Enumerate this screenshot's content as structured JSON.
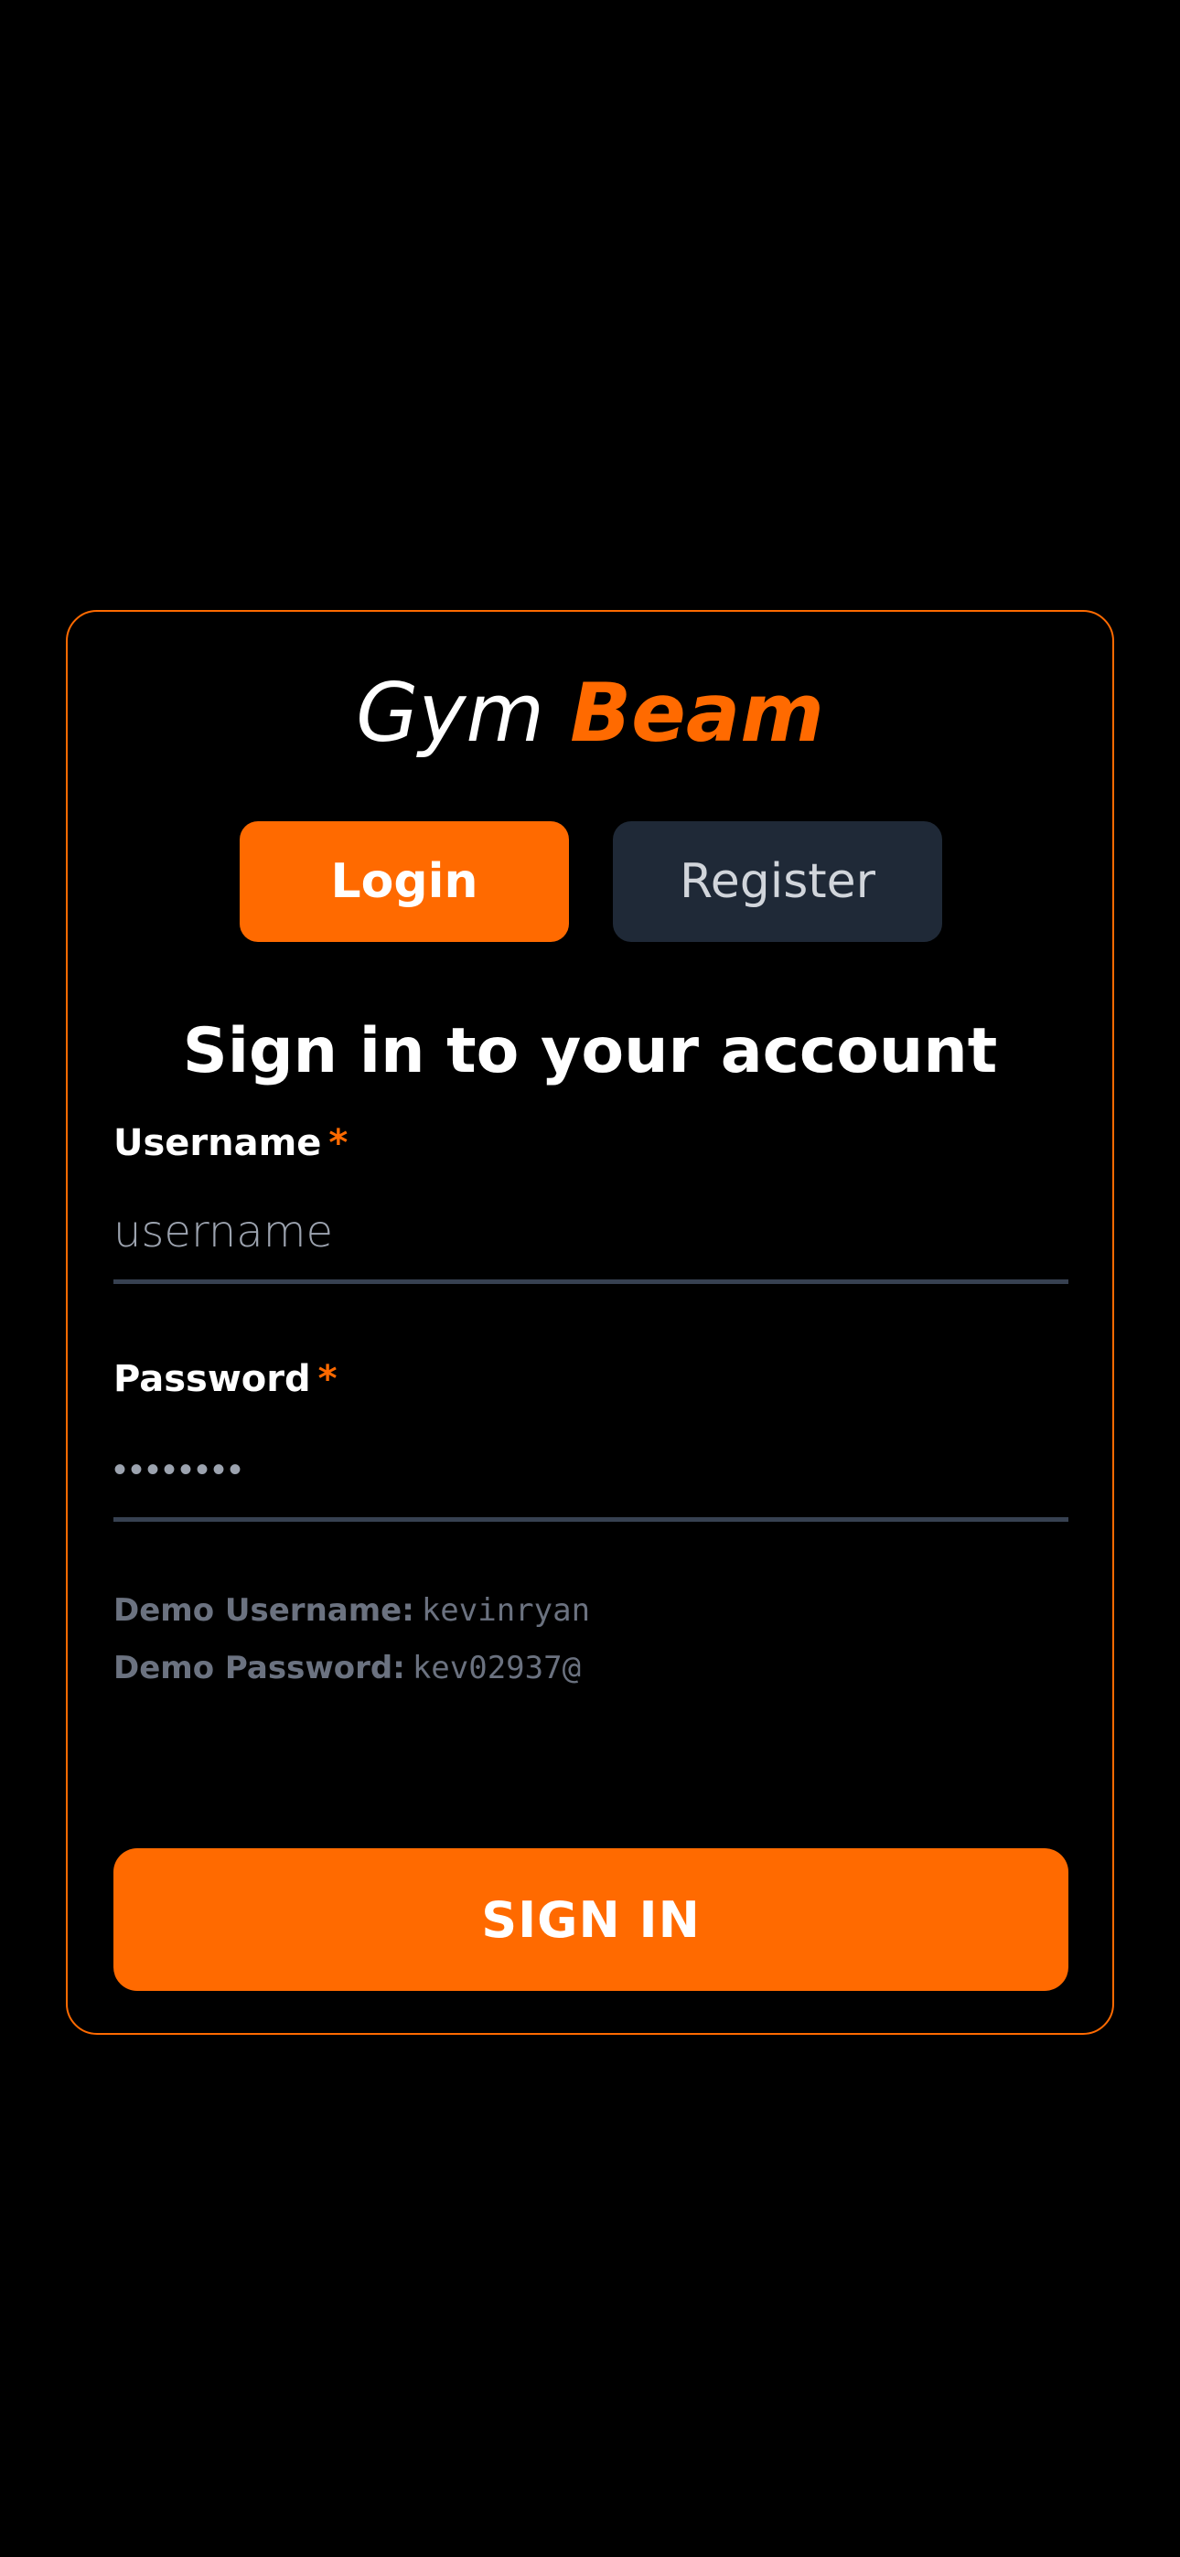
{
  "brand": {
    "first": "Gym",
    "second": "Beam"
  },
  "tabs": {
    "login": "Login",
    "register": "Register"
  },
  "heading": "Sign in to your account",
  "fields": {
    "username": {
      "label": "Username",
      "required_mark": "*",
      "placeholder": "username"
    },
    "password": {
      "label": "Password",
      "required_mark": "*",
      "placeholder": "••••••••"
    }
  },
  "demo": {
    "username_label": "Demo Username:",
    "username_value": "kevinryan",
    "password_label": "Demo Password:",
    "password_value": "kev02937@"
  },
  "submit_label": "SIGN IN",
  "colors": {
    "accent": "#ff6a00",
    "background": "#000000",
    "secondary_tab": "#1f2937",
    "input_border": "#374151",
    "muted_text": "#6b7280"
  }
}
